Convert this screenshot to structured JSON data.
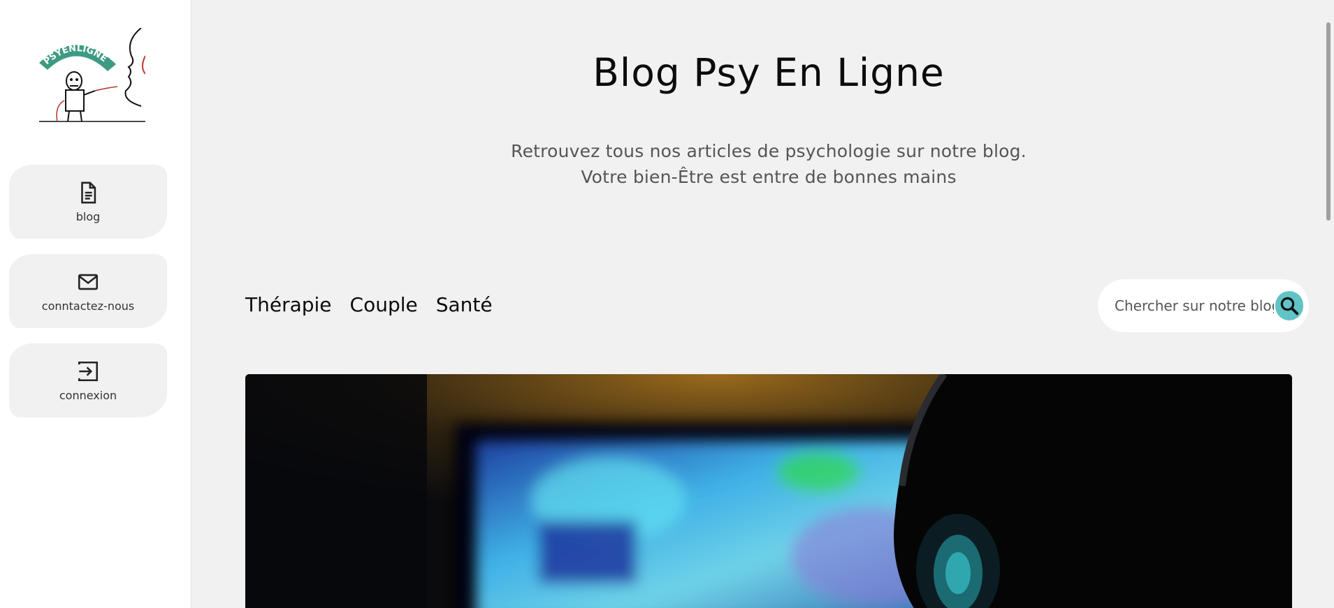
{
  "logo": {
    "text": "PSYENLIGNE",
    "icon": "logo-psyenligne-icon"
  },
  "sidebar": {
    "items": [
      {
        "label": "blog",
        "icon": "document-icon"
      },
      {
        "label": "conntactez-nous",
        "icon": "envelope-icon"
      },
      {
        "label": "connexion",
        "icon": "login-icon"
      }
    ]
  },
  "header": {
    "title": "Blog Psy En Ligne",
    "subtitle": "Retrouvez tous nos articles de psychologie sur notre blog. Votre bien-Être est entre de bonnes mains"
  },
  "categories": [
    "Thérapie",
    "Couple",
    "Santé"
  ],
  "search": {
    "placeholder": "Chercher sur notre blog",
    "icon": "search-icon"
  },
  "colors": {
    "accent": "#60c3c6",
    "logo_green": "#3f9a83",
    "background": "#f1f1f1"
  }
}
